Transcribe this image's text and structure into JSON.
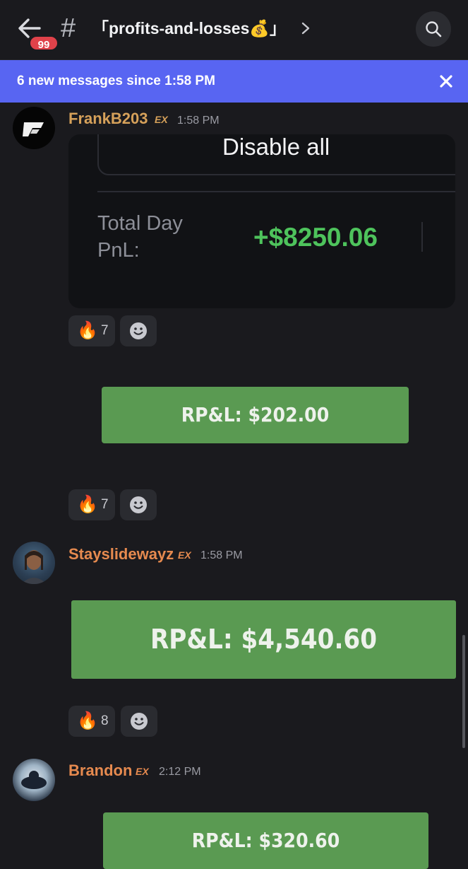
{
  "header": {
    "unread_count": "99",
    "hash_symbol": "#",
    "channel_name": "「profits-and-losses💰」"
  },
  "banner": {
    "text": "6 new messages since 1:58 PM"
  },
  "messages": [
    {
      "author": "FrankB203",
      "time": "1:58 PM",
      "embed": {
        "button_label": "Disable all",
        "pnl_label_line1": "Total Day",
        "pnl_label_line2": "PnL:",
        "pnl_value": "+$8250.06"
      },
      "reactions": {
        "fire_count": "7"
      },
      "card_text": "RP&L: $202.00",
      "card_reactions": {
        "fire_count": "7"
      }
    },
    {
      "author": "Stayslidewayz",
      "time": "1:58 PM",
      "card_text": "RP&L: $4,540.60",
      "reactions": {
        "fire_count": "8"
      }
    },
    {
      "author": "Brandon",
      "time": "2:12 PM",
      "card_text": "RP&L: $320.60"
    }
  ],
  "colors": {
    "accent_banner": "#5865f2",
    "badge_red": "#e0424a",
    "profit_green": "#4ec35c",
    "card_green": "#5a9a52"
  }
}
